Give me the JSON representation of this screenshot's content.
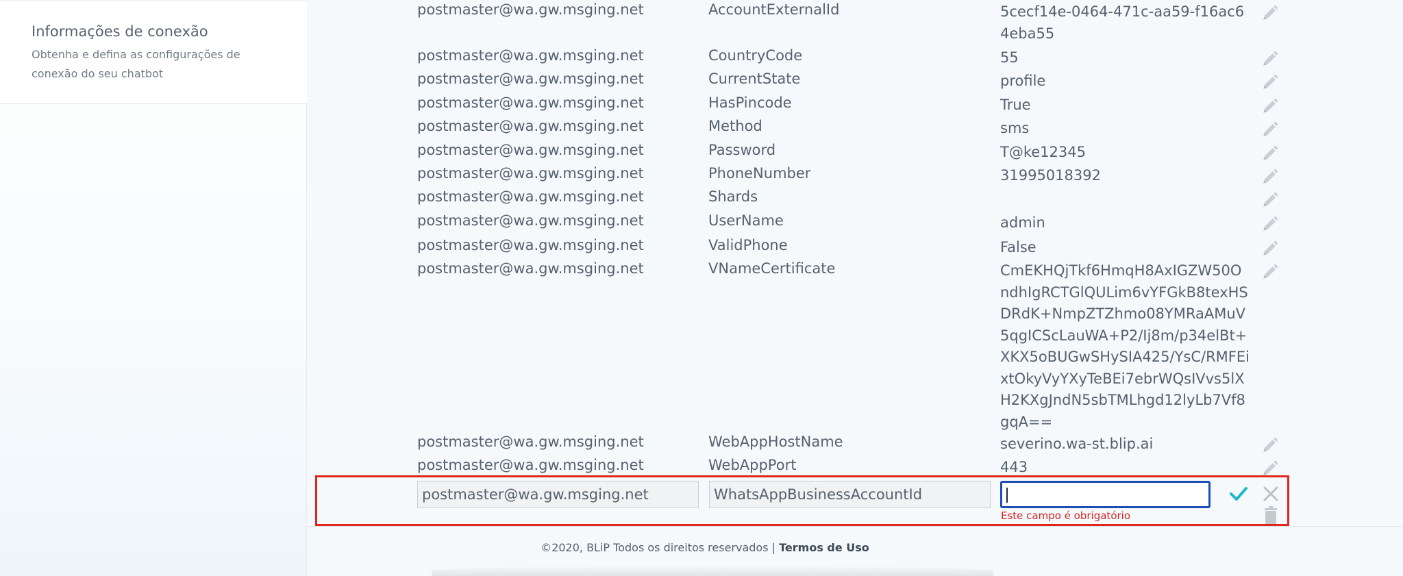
{
  "sidebar": {
    "title": "Informações de conexão",
    "description": "Obtenha e defina as configurações de conexão do seu chatbot"
  },
  "rows": [
    {
      "identity": "postmaster@wa.gw.msging.net",
      "key": "AccountExternalId",
      "value": "5cecf14e-0464-471c-aa59-f16ac64eba55"
    },
    {
      "identity": "postmaster@wa.gw.msging.net",
      "key": "CountryCode",
      "value": "55"
    },
    {
      "identity": "postmaster@wa.gw.msging.net",
      "key": "CurrentState",
      "value": "profile"
    },
    {
      "identity": "postmaster@wa.gw.msging.net",
      "key": "HasPincode",
      "value": "True"
    },
    {
      "identity": "postmaster@wa.gw.msging.net",
      "key": "Method",
      "value": "sms"
    },
    {
      "identity": "postmaster@wa.gw.msging.net",
      "key": "Password",
      "value": "T@ke12345"
    },
    {
      "identity": "postmaster@wa.gw.msging.net",
      "key": "PhoneNumber",
      "value": "31995018392"
    },
    {
      "identity": "postmaster@wa.gw.msging.net",
      "key": "Shards",
      "value": ""
    },
    {
      "identity": "postmaster@wa.gw.msging.net",
      "key": "UserName",
      "value": "admin"
    },
    {
      "identity": "postmaster@wa.gw.msging.net",
      "key": "ValidPhone",
      "value": "False"
    },
    {
      "identity": "postmaster@wa.gw.msging.net",
      "key": "VNameCertificate",
      "value": "CmEKHQjTkf6HmqH8AxIGZW50OndhIgRCTGlQULim6vYFGkB8texHSDRdK+NmpZTZhmo08YMRaAMuV5qgICScLauWA+P2/Ij8m/p34elBt+XKX5oBUGwSHySIA425/YsC/RMFEixtOkyVyYXyTeBEi7ebrWQsIVvs5lXH2KXgJndN5sbTMLhgd12lyLb7Vf8gqA=="
    },
    {
      "identity": "postmaster@wa.gw.msging.net",
      "key": "WebAppHostName",
      "value": "severino.wa-st.blip.ai"
    },
    {
      "identity": "postmaster@wa.gw.msging.net",
      "key": "WebAppPort",
      "value": "443"
    }
  ],
  "new_row": {
    "identity": "postmaster@wa.gw.msging.net",
    "key": "WhatsAppBusinessAccountId",
    "value": "",
    "error": "Este campo é obrigatório"
  },
  "footer": {
    "copyright": "©2020, BLiP Todos os direitos reservados |",
    "link": "Termos de Uso"
  },
  "colors": {
    "highlight_border": "#e3241b",
    "input_focus": "#1d4fb3",
    "confirm": "#1fb8c9",
    "error": "#d42424"
  },
  "icons": {
    "edit": "pencil-icon",
    "confirm": "check-icon",
    "cancel": "close-icon",
    "delete": "trash-icon"
  }
}
